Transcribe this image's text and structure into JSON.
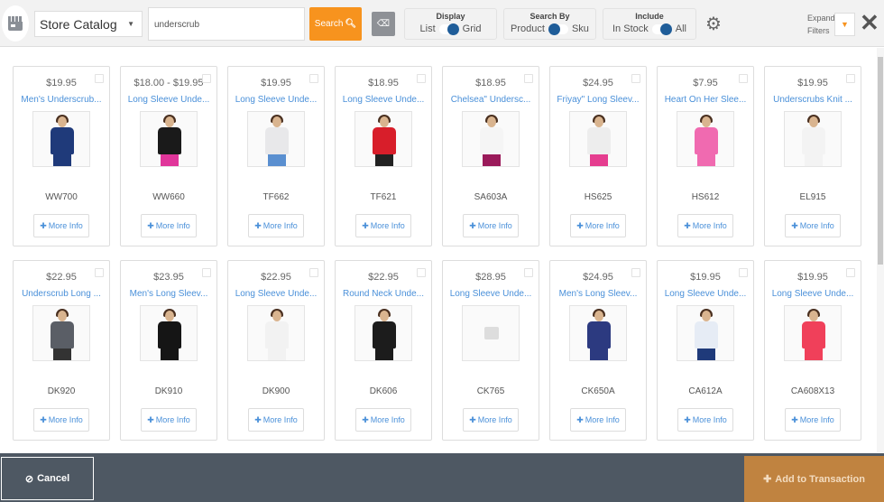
{
  "toolbar": {
    "catalog_select": "Store Catalog",
    "search_value": "underscrub",
    "search_label": "Search",
    "display": {
      "title": "Display",
      "left": "List",
      "right": "Grid",
      "selected": "Grid"
    },
    "search_by": {
      "title": "Search By",
      "left": "Product",
      "right": "Sku",
      "selected": "Product"
    },
    "include": {
      "title": "Include",
      "left": "In Stock",
      "right": "All",
      "selected": "All"
    },
    "expand_line1": "Expand",
    "expand_line2": "Filters"
  },
  "more_info_label": "More Info",
  "products": [
    {
      "price": "$19.95",
      "name": "Men's Underscrub...",
      "sku": "WW700",
      "shirt_color": "#1f3a7a",
      "pants_color": "#1f3a7a"
    },
    {
      "price": "$18.00 - $19.95",
      "name": "Long Sleeve Unde...",
      "sku": "WW660",
      "shirt_color": "#1a1a1a",
      "pants_color": "#e0359a"
    },
    {
      "price": "$19.95",
      "name": "Long Sleeve Unde...",
      "sku": "TF662",
      "shirt_color": "#e8e8ea",
      "pants_color": "#5a8fd0"
    },
    {
      "price": "$18.95",
      "name": "Long Sleeve Unde...",
      "sku": "TF621",
      "shirt_color": "#d81e2a",
      "pants_color": "#222"
    },
    {
      "price": "$18.95",
      "name": "Chelsea\" Undersc...",
      "sku": "SA603A",
      "shirt_color": "#f5f5f5",
      "pants_color": "#9a1a5a"
    },
    {
      "price": "$24.95",
      "name": "Friyay\" Long Sleev...",
      "sku": "HS625",
      "shirt_color": "#ededed",
      "pants_color": "#e53d8f"
    },
    {
      "price": "$7.95",
      "name": "Heart On Her Slee...",
      "sku": "HS612",
      "shirt_color": "#f06ab0",
      "pants_color": "#f06ab0"
    },
    {
      "price": "$19.95",
      "name": "Underscrubs Knit ...",
      "sku": "EL915",
      "shirt_color": "#f3f3f3",
      "pants_color": "#f3f3f3"
    },
    {
      "price": "$22.95",
      "name": "Underscrub Long ...",
      "sku": "DK920",
      "shirt_color": "#5a5e66",
      "pants_color": "#333"
    },
    {
      "price": "$23.95",
      "name": "Men's Long Sleev...",
      "sku": "DK910",
      "shirt_color": "#151515",
      "pants_color": "#151515"
    },
    {
      "price": "$22.95",
      "name": "Long Sleeve Unde...",
      "sku": "DK900",
      "shirt_color": "#f2f2f2",
      "pants_color": "#f2f2f2"
    },
    {
      "price": "$22.95",
      "name": "Round Neck Unde...",
      "sku": "DK606",
      "shirt_color": "#1c1c1c",
      "pants_color": "#1c1c1c"
    },
    {
      "price": "$28.95",
      "name": "Long Sleeve Unde...",
      "sku": "CK765",
      "shirt_color": "",
      "pants_color": ""
    },
    {
      "price": "$24.95",
      "name": "Men's Long Sleev...",
      "sku": "CK650A",
      "shirt_color": "#2c3a80",
      "pants_color": "#2c3a80"
    },
    {
      "price": "$19.95",
      "name": "Long Sleeve Unde...",
      "sku": "CA612A",
      "shirt_color": "#e6ecf5",
      "pants_color": "#1f3a7a"
    },
    {
      "price": "$19.95",
      "name": "Long Sleeve Unde...",
      "sku": "CA608X13",
      "shirt_color": "#f0405a",
      "pants_color": "#f0405a"
    }
  ],
  "footer": {
    "cancel_label": "Cancel",
    "add_label": "Add to Transaction"
  }
}
